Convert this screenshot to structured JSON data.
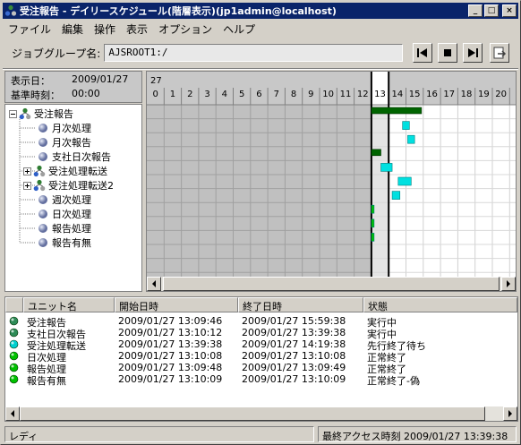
{
  "window": {
    "title": "受注報告 - デイリースケジュール(階層表示)(jp1admin@localhost)",
    "minimize_glyph": "_",
    "maximize_glyph": "□",
    "close_glyph": "×"
  },
  "menu": [
    "ファイル",
    "編集",
    "操作",
    "表示",
    "オプション",
    "ヘルプ"
  ],
  "toolbar": {
    "label": "ジョブグループ名:",
    "value": "AJSROOT1:/",
    "buttons": [
      "previous-button",
      "stop-button",
      "next-button",
      "refresh-button"
    ]
  },
  "info": {
    "display_date_label": "表示日：",
    "display_date": "2009/01/27",
    "base_time_label": "基準時刻：",
    "base_time": "00:00"
  },
  "tree": {
    "root": "受注報告",
    "items": [
      {
        "label": "月次処理",
        "type": "job",
        "expandable": false
      },
      {
        "label": "月次報告",
        "type": "job",
        "expandable": false
      },
      {
        "label": "支社日次報告",
        "type": "job",
        "expandable": false
      },
      {
        "label": "受注処理転送",
        "type": "net",
        "expandable": true
      },
      {
        "label": "受注処理転送2",
        "type": "net",
        "expandable": true
      },
      {
        "label": "週次処理",
        "type": "job",
        "expandable": false
      },
      {
        "label": "日次処理",
        "type": "job",
        "expandable": false
      },
      {
        "label": "報告処理",
        "type": "job",
        "expandable": false
      },
      {
        "label": "報告有無",
        "type": "job",
        "expandable": false
      }
    ]
  },
  "gantt": {
    "day_label": "27",
    "hours": [
      "0",
      "1",
      "2",
      "3",
      "4",
      "5",
      "6",
      "7",
      "8",
      "9",
      "10",
      "11",
      "12",
      "13",
      "14",
      "15",
      "16",
      "17",
      "18",
      "19",
      "20"
    ],
    "current_hour": 13,
    "bars": [
      {
        "row": 0,
        "start": 13.0,
        "end": 15.9,
        "color": "#006400"
      },
      {
        "row": 1,
        "start": 14.8,
        "end": 15.2,
        "color": "#00e0e0"
      },
      {
        "row": 2,
        "start": 15.1,
        "end": 15.5,
        "color": "#00e0e0"
      },
      {
        "row": 3,
        "start": 13.0,
        "end": 13.55,
        "color": "#006400"
      },
      {
        "row": 4,
        "start": 13.55,
        "end": 14.2,
        "color": "#00e0e0"
      },
      {
        "row": 5,
        "start": 14.55,
        "end": 15.3,
        "color": "#00e0e0"
      },
      {
        "row": 6,
        "start": 14.2,
        "end": 14.65,
        "color": "#00e0e0"
      },
      {
        "row": 7,
        "start": 13.0,
        "end": 13.15,
        "color": "#00c000"
      },
      {
        "row": 8,
        "start": 13.0,
        "end": 13.15,
        "color": "#00c000"
      },
      {
        "row": 9,
        "start": 13.0,
        "end": 13.15,
        "color": "#00c000"
      }
    ]
  },
  "list": {
    "headers": [
      "ユニット名",
      "開始日時",
      "終了日時",
      "状態"
    ],
    "rows": [
      {
        "icon_color": "#2e8b57",
        "name": "受注報告",
        "start": "2009/01/27 13:09:46",
        "end": "2009/01/27 15:59:38",
        "status": "実行中"
      },
      {
        "icon_color": "#2e8b57",
        "name": "支社日次報告",
        "start": "2009/01/27 13:10:12",
        "end": "2009/01/27 13:39:38",
        "status": "実行中"
      },
      {
        "icon_color": "#00d0d0",
        "name": "受注処理転送",
        "start": "2009/01/27 13:39:38",
        "end": "2009/01/27 14:19:38",
        "status": "先行終了待ち"
      },
      {
        "icon_color": "#00c000",
        "name": "日次処理",
        "start": "2009/01/27 13:10:08",
        "end": "2009/01/27 13:10:08",
        "status": "正常終了"
      },
      {
        "icon_color": "#00c000",
        "name": "報告処理",
        "start": "2009/01/27 13:09:48",
        "end": "2009/01/27 13:09:49",
        "status": "正常終了"
      },
      {
        "icon_color": "#00c000",
        "name": "報告有無",
        "start": "2009/01/27 13:10:09",
        "end": "2009/01/27 13:10:09",
        "status": "正常終了-偽"
      }
    ]
  },
  "status": {
    "left": "レディ",
    "right": "最終アクセス時刻 2009/01/27 13:39:38"
  }
}
